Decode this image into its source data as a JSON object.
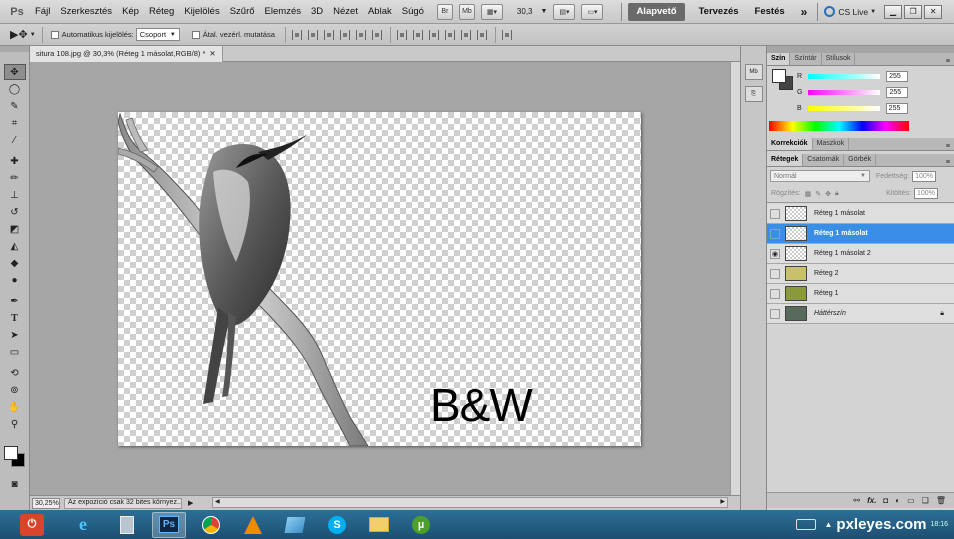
{
  "menubar": {
    "app_icon": "Ps",
    "items": [
      "Fájl",
      "Szerkesztés",
      "Kép",
      "Réteg",
      "Kijelölés",
      "Szűrő",
      "Elemzés",
      "3D",
      "Nézet",
      "Ablak",
      "Súgó"
    ],
    "bridge_label": "Br",
    "minibridge_label": "Mb",
    "zoom_value": "30,3",
    "workspaces": [
      "Alapvető",
      "Tervezés",
      "Festés"
    ],
    "more_label": "»",
    "cslive_label": "CS Live"
  },
  "options": {
    "auto_select_label": "Automatikus kijelölés:",
    "auto_select_value": "Csoport",
    "transform_controls_label": "Átal. vezérl. mutatása"
  },
  "document": {
    "tab_title": "situra 108.jpg @ 30,3% (Réteg 1 másolat,RGB/8) *",
    "canvas_text": "B&W",
    "zoom": "30,25%",
    "status": "Az expozíció csak 32 bites környez..."
  },
  "color_panel": {
    "tabs": [
      "Szín",
      "Színtár",
      "Stílusok"
    ],
    "channels": [
      {
        "label": "R",
        "value": "255"
      },
      {
        "label": "G",
        "value": "255"
      },
      {
        "label": "B",
        "value": "255"
      }
    ]
  },
  "adjust_panel": {
    "tabs": [
      "Korrekciók",
      "Maszkok"
    ]
  },
  "layers_panel": {
    "tabs": [
      "Rétegek",
      "Csatornák",
      "Görbék"
    ],
    "blend_mode": "Normál",
    "opacity_label": "Fedettség:",
    "opacity_value": "100%",
    "lock_label": "Rögzítés:",
    "fill_label": "Kitöltés:",
    "fill_value": "100%",
    "layers": [
      {
        "name": "Réteg 1 másolat",
        "visible": false,
        "selected": false
      },
      {
        "name": "Réteg 1 másolat",
        "visible": false,
        "selected": true
      },
      {
        "name": "Réteg 1 másolat 2",
        "visible": true,
        "selected": false
      },
      {
        "name": "Réteg 2",
        "visible": false,
        "selected": false
      },
      {
        "name": "Réteg 1",
        "visible": false,
        "selected": false
      },
      {
        "name": "Háttérszín",
        "visible": false,
        "selected": false,
        "locked": true
      }
    ],
    "footer_fx": "fx."
  },
  "taskbar": {
    "ps_label": "Ps",
    "watermark": "pxleyes.com",
    "clock": "18:16"
  }
}
